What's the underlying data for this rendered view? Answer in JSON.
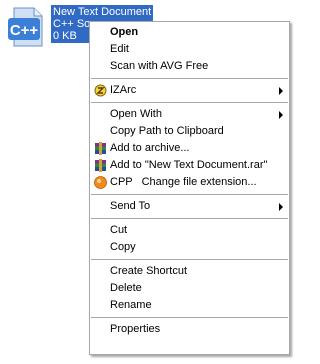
{
  "file": {
    "name": "New Text Document",
    "type": "C++ Source",
    "size": "0 KB",
    "icon_text": "C++",
    "selection_color": "#316ac5"
  },
  "menu": {
    "open": "Open",
    "edit": "Edit",
    "scan": "Scan with AVG Free",
    "izarc": "IZArc",
    "open_with": "Open With",
    "copy_path": "Copy Path to Clipboard",
    "add_archive": "Add to archive...",
    "add_rar": "Add to \"New Text Document.rar\"",
    "cpp_ext": "CPP   Change file extension...",
    "send_to": "Send To",
    "cut": "Cut",
    "copy": "Copy",
    "create_shortcut": "Create Shortcut",
    "delete": "Delete",
    "rename": "Rename",
    "properties": "Properties"
  }
}
